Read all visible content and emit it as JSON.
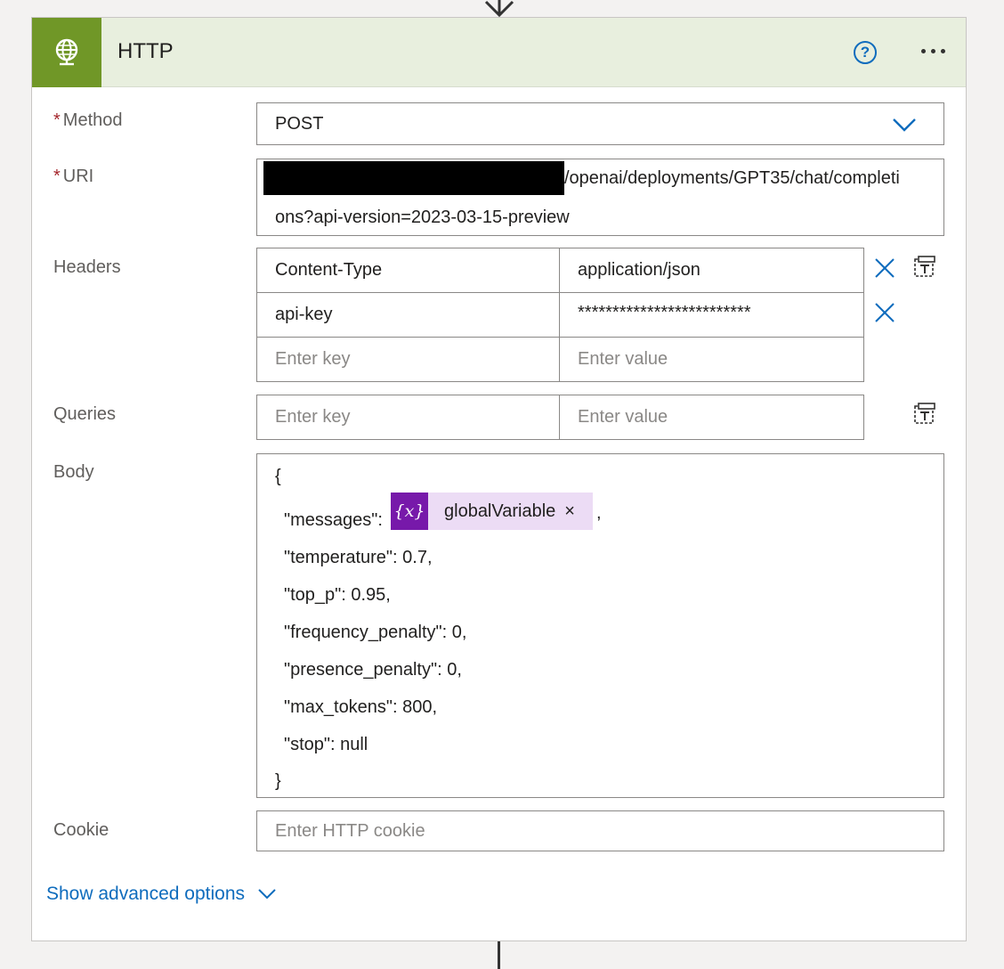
{
  "card": {
    "title": "HTTP",
    "help_glyph": "?",
    "icons": {
      "header": "globe-network-icon",
      "help": "question-circle-icon",
      "more": "more-dots-icon"
    }
  },
  "method": {
    "label": "Method",
    "required_marker": "*",
    "value": "POST"
  },
  "uri": {
    "label": "URI",
    "required_marker": "*",
    "line1": "/openai/deployments/GPT35/chat/completi",
    "line2": "ons?api-version=2023-03-15-preview"
  },
  "headers": {
    "label": "Headers",
    "rows": [
      {
        "key": "Content-Type",
        "value": "application/json"
      },
      {
        "key": "api-key",
        "value": "*************************"
      }
    ],
    "key_placeholder": "Enter key",
    "value_placeholder": "Enter value"
  },
  "queries": {
    "label": "Queries",
    "key_placeholder": "Enter key",
    "value_placeholder": "Enter value"
  },
  "body": {
    "label": "Body",
    "open_brace": "{",
    "messages_key": "\"messages\":",
    "token": {
      "icon_text": "{x}",
      "label": "globalVariable",
      "close": "×"
    },
    "comma": ",",
    "lines": [
      "\"temperature\": 0.7,",
      "\"top_p\": 0.95,",
      "\"frequency_penalty\": 0,",
      "\"presence_penalty\": 0,",
      "\"max_tokens\": 800,",
      "\"stop\": null"
    ],
    "close_brace": "}"
  },
  "cookie": {
    "label": "Cookie",
    "placeholder": "Enter HTTP cookie"
  },
  "advanced": {
    "label": "Show advanced options"
  },
  "colors": {
    "accent": "#0f6cbd",
    "header_bg": "#e8efde",
    "icon_bg": "#709727",
    "token_bg": "#ecdcf5",
    "token_icon_bg": "#7719aa"
  }
}
